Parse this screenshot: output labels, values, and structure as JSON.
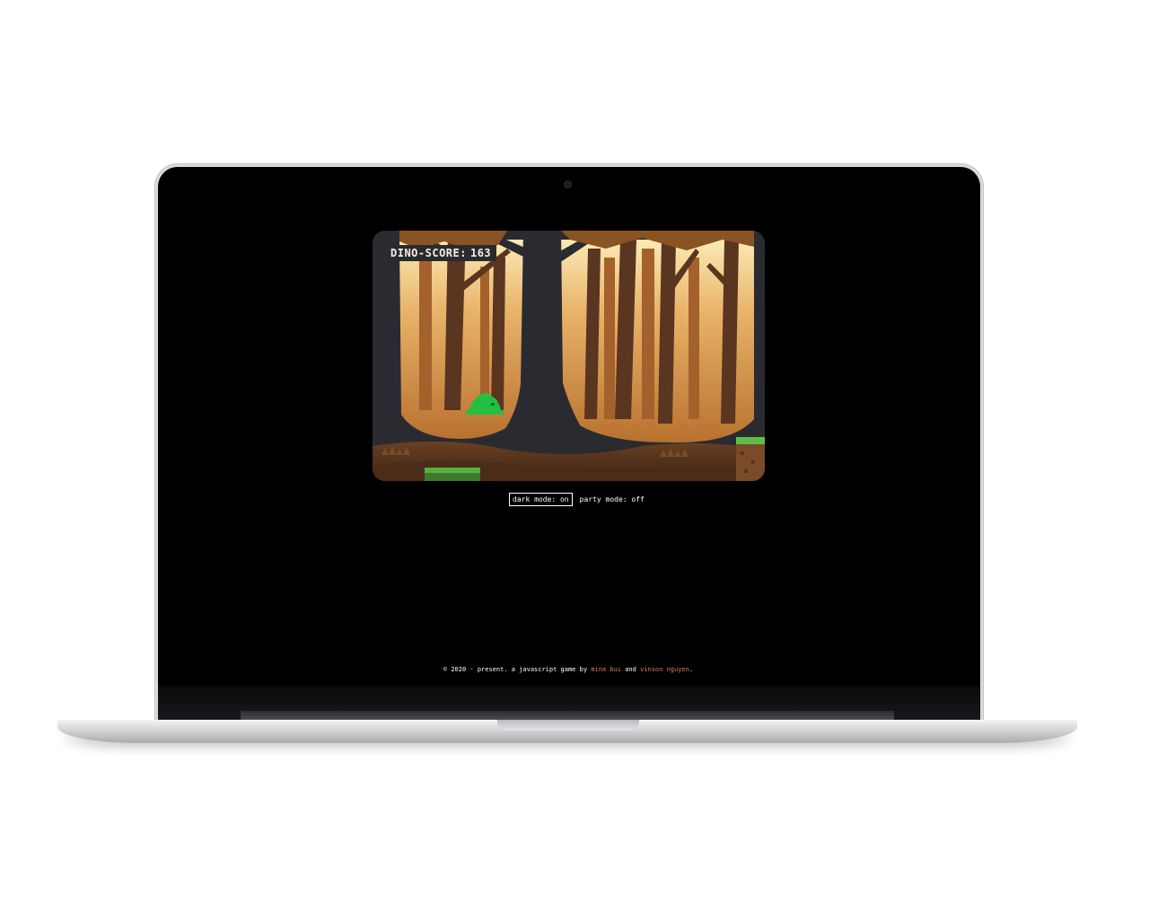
{
  "game": {
    "score_label": "DINO-SCORE:",
    "score_value": "163"
  },
  "controls": {
    "dark_mode": "dark mode: on",
    "party_mode": "party mode: off"
  },
  "footer": {
    "prefix": "© 2020 - present. a javascript game by",
    "author1": "mina bui",
    "and": "and",
    "author2": "vinson nguyen",
    "suffix": "."
  },
  "colors": {
    "link": "#e07a5f",
    "dino": "#22c040",
    "sky": "#f6dca0",
    "dark_tree": "#2a2b31"
  }
}
